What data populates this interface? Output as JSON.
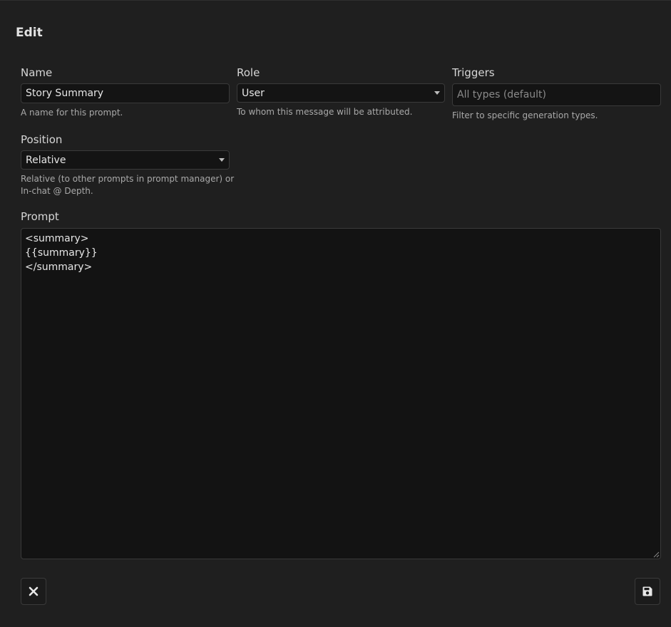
{
  "dialog": {
    "title": "Edit"
  },
  "fields": {
    "name": {
      "label": "Name",
      "value": "Story Summary",
      "hint": "A name for this prompt."
    },
    "role": {
      "label": "Role",
      "value": "User",
      "hint": "To whom this message will be attributed."
    },
    "triggers": {
      "label": "Triggers",
      "placeholder": "All types (default)",
      "hint": "Filter to specific generation types."
    },
    "position": {
      "label": "Position",
      "value": "Relative",
      "hint_line1": "Relative (to other prompts in prompt manager) or",
      "hint_line2": "In-chat @ Depth."
    },
    "prompt": {
      "label": "Prompt",
      "value": "<summary>\n{{summary}}\n</summary>"
    }
  },
  "icons": {
    "close": "close-icon",
    "save": "floppy-disk-icon"
  },
  "colors": {
    "background": "#1f1f1f",
    "input_background": "#141414",
    "border": "#3a3a3a",
    "text": "#e6e6e6",
    "hint": "#a9a9a9"
  }
}
